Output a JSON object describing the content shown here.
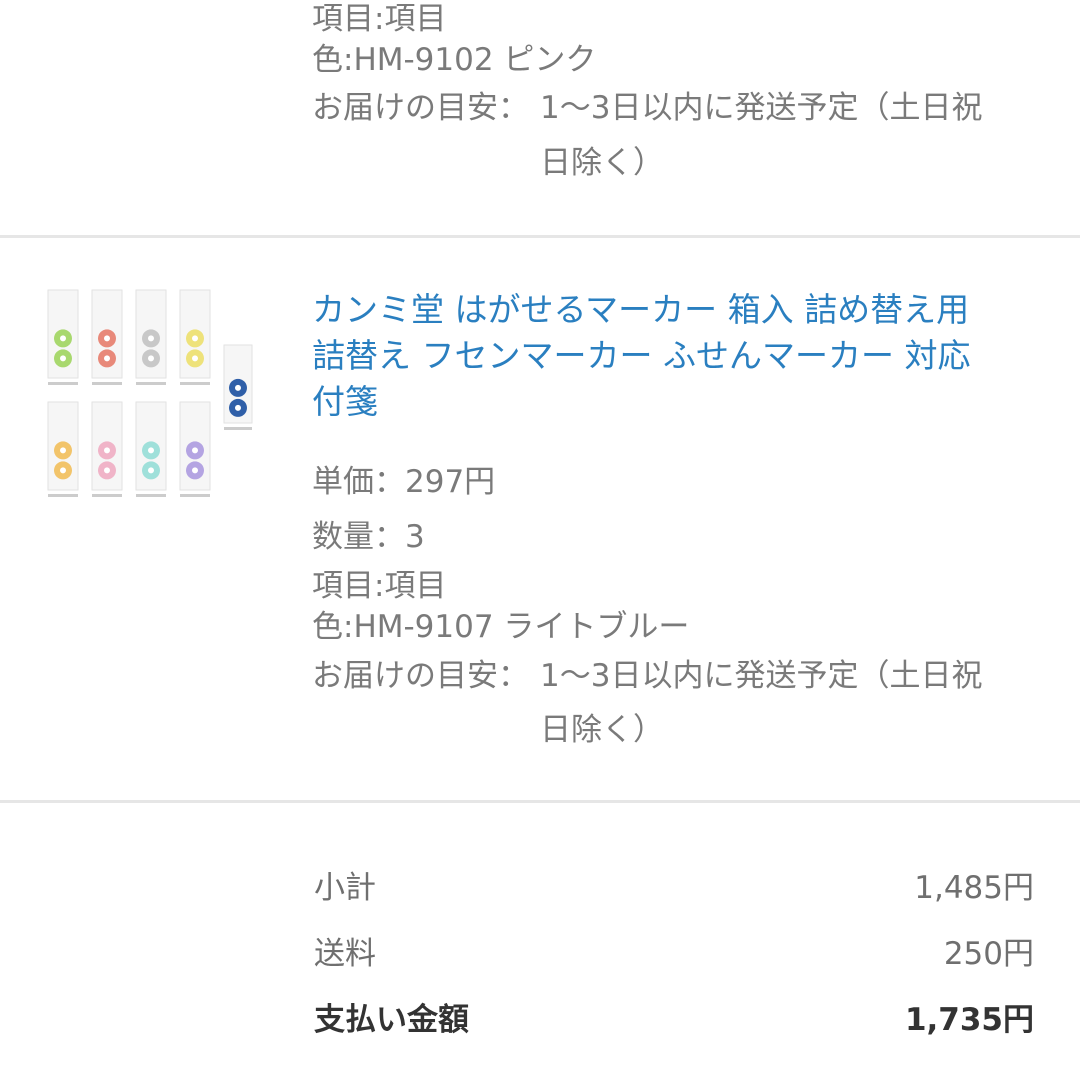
{
  "item1": {
    "option_label": "項目:項目",
    "color_label": "色:HM-9102 ピンク",
    "delivery_label": "お届けの目安：",
    "delivery_line1": "1〜3日以内に発送予定（土日祝",
    "delivery_line2": "日除く）"
  },
  "item2": {
    "title_line1": "カンミ堂 はがせるマーカー 箱入 詰め替え用",
    "title_line2": "詰替え フセンマーカー ふせんマーカー 対応",
    "title_line3": "付箋",
    "unit_price": "単価：297円",
    "quantity": "数量：3",
    "option_label": "項目:項目",
    "color_label": "色:HM-9107 ライトブルー",
    "delivery_label": "お届けの目安：",
    "delivery_line1": "1〜3日以内に発送予定（土日祝",
    "delivery_line2": "日除く）",
    "thumbnail_colors": {
      "row1": [
        "#a8d86e",
        "#e8897a",
        "#c8c8c8",
        "#eee27a"
      ],
      "row2": [
        "#f2c46a",
        "#f0b4c8",
        "#9fe0da",
        "#b4a4e2"
      ],
      "single": "#2f5fa8"
    }
  },
  "summary": {
    "subtotal_label": "小計",
    "subtotal_value": "1,485円",
    "shipping_label": "送料",
    "shipping_value": "250円",
    "total_label": "支払い金額",
    "total_value": "1,735円"
  }
}
